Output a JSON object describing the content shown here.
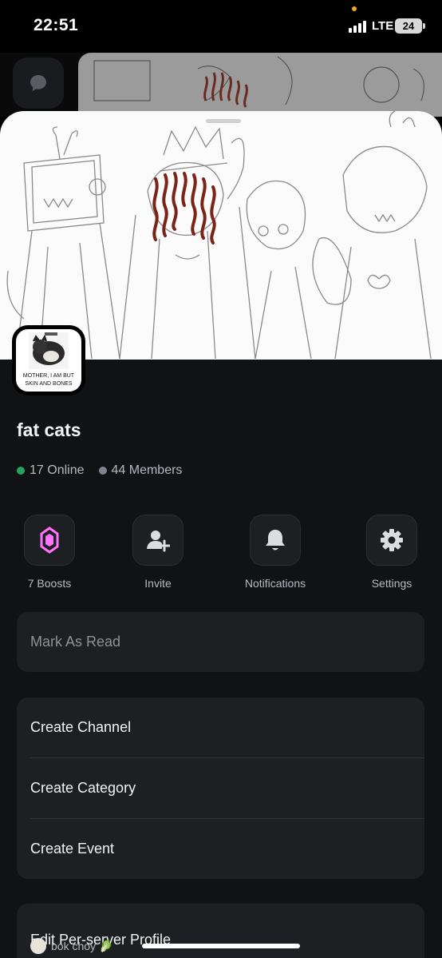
{
  "status_bar": {
    "time": "22:51",
    "network": "LTE",
    "battery": "24"
  },
  "server": {
    "name": "fat cats",
    "icon_caption_line1": "MOTHER, I AM BUT",
    "icon_caption_line2": "SKIN AND BONES",
    "online_count": "17 Online",
    "member_count": "44 Members"
  },
  "actions": [
    {
      "label": "7 Boosts",
      "icon": "boost-gem-icon"
    },
    {
      "label": "Invite",
      "icon": "add-user-icon"
    },
    {
      "label": "Notifications",
      "icon": "bell-icon"
    },
    {
      "label": "Settings",
      "icon": "gear-icon"
    }
  ],
  "menu": {
    "mark_as_read": "Mark As Read",
    "create_channel": "Create Channel",
    "create_category": "Create Category",
    "create_event": "Create Event",
    "edit_profile": "Edit Per-server Profile"
  },
  "profile": {
    "nickname": "bok choy",
    "nickname_emoji": "🥬"
  },
  "colors": {
    "online": "#23a55a",
    "boost": "#ff73fa",
    "sheet_bg": "#111214",
    "card_bg": "#1e1f22"
  }
}
